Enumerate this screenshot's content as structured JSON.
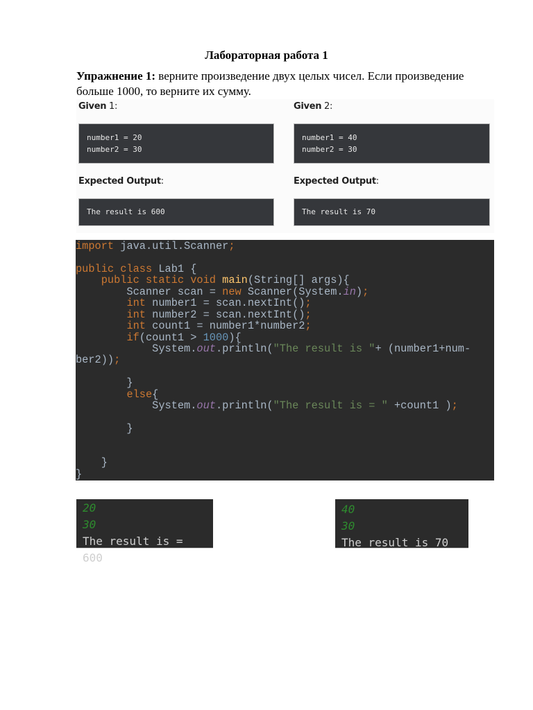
{
  "title": "Лабораторная работа 1",
  "exercise": {
    "label": "Упражнение 1:",
    "text": " верните произведение двух целых чисел. Если произведение больше 1000, то верните их сумму."
  },
  "given": [
    {
      "label": "Given",
      "num": " 1:",
      "input": [
        "number1 = 20",
        "number2 = 30"
      ],
      "expected_label": "Expected Output",
      "expected_colon": ":",
      "expected": "The result is 600"
    },
    {
      "label": "Given",
      "num": " 2:",
      "input": [
        "number1 = 40",
        "number2 = 30"
      ],
      "expected_label": "Expected Output",
      "expected_colon": ":",
      "expected": "The result is 70"
    }
  ],
  "code_lines": [
    [
      [
        "kw",
        "import "
      ],
      [
        "pl",
        "java.util.Scanner"
      ],
      [
        "kw",
        ";"
      ]
    ],
    [],
    [
      [
        "kw",
        "public class "
      ],
      [
        "pl",
        "Lab1 {"
      ]
    ],
    [
      [
        "pl",
        "    "
      ],
      [
        "kw",
        "public static void "
      ],
      [
        "fn",
        "main"
      ],
      [
        "pl",
        "(String[] args){"
      ]
    ],
    [
      [
        "pl",
        "        Scanner scan = "
      ],
      [
        "kw",
        "new "
      ],
      [
        "pl",
        "Scanner(System."
      ],
      [
        "it",
        "in"
      ],
      [
        "pl",
        ")"
      ],
      [
        "kw",
        ";"
      ]
    ],
    [
      [
        "pl",
        "        "
      ],
      [
        "kw",
        "int "
      ],
      [
        "pl",
        "number1 = scan.nextInt()"
      ],
      [
        "kw",
        ";"
      ]
    ],
    [
      [
        "pl",
        "        "
      ],
      [
        "kw",
        "int "
      ],
      [
        "pl",
        "number2 = scan.nextInt()"
      ],
      [
        "kw",
        ";"
      ]
    ],
    [
      [
        "pl",
        "        "
      ],
      [
        "kw",
        "int "
      ],
      [
        "pl",
        "count1 = number1*number2"
      ],
      [
        "kw",
        ";"
      ]
    ],
    [
      [
        "pl",
        "        "
      ],
      [
        "kw",
        "if"
      ],
      [
        "pl",
        "(count1 > "
      ],
      [
        "num",
        "1000"
      ],
      [
        "pl",
        "){"
      ]
    ],
    [
      [
        "pl",
        "            System."
      ],
      [
        "it",
        "out"
      ],
      [
        "pl",
        ".println("
      ],
      [
        "st",
        "\"The result is \""
      ],
      [
        "pl",
        "+ (number1+num-"
      ]
    ],
    [
      [
        "pl",
        "ber2))"
      ],
      [
        "kw",
        ";"
      ]
    ],
    [],
    [
      [
        "pl",
        "        }"
      ]
    ],
    [
      [
        "pl",
        "        "
      ],
      [
        "kw",
        "else"
      ],
      [
        "pl",
        "{"
      ]
    ],
    [
      [
        "pl",
        "            System."
      ],
      [
        "it",
        "out"
      ],
      [
        "pl",
        ".println("
      ],
      [
        "st",
        "\"The result is = \""
      ],
      [
        "pl",
        " +count1 )"
      ],
      [
        "kw",
        ";"
      ]
    ],
    [],
    [
      [
        "pl",
        "        }"
      ]
    ],
    [],
    [],
    [
      [
        "pl",
        "    }"
      ]
    ],
    [
      [
        "pl",
        "}"
      ]
    ]
  ],
  "console": [
    {
      "inputs": [
        "20",
        "30"
      ],
      "result": "The result is = 600"
    },
    {
      "inputs": [
        "40",
        "30"
      ],
      "result": "The result is 70"
    }
  ]
}
